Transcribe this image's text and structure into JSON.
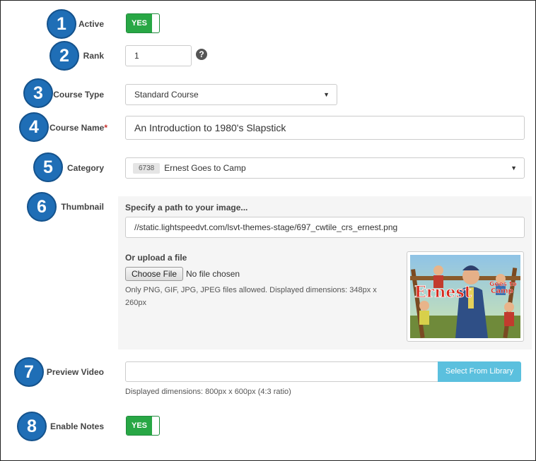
{
  "fields": {
    "active": {
      "num": "1",
      "label": "Active",
      "toggle": "YES"
    },
    "rank": {
      "num": "2",
      "label": "Rank",
      "value": "1",
      "help": "?"
    },
    "course_type": {
      "num": "3",
      "label": "Course Type",
      "value": "Standard Course"
    },
    "course_name": {
      "num": "4",
      "label": "Course Name",
      "required": "*",
      "value": "An Introduction to 1980's Slapstick"
    },
    "category": {
      "num": "5",
      "label": "Category",
      "badge": "6738",
      "value": "Ernest Goes to Camp"
    },
    "thumbnail": {
      "num": "6",
      "label": "Thumbnail",
      "path_title": "Specify a path to your image...",
      "path_value": "//static.lightspeedvt.com/lsvt-themes-stage/697_cwtile_crs_ernest.png",
      "upload_title": "Or upload a file",
      "choose_label": "Choose File",
      "no_file": "No file chosen",
      "hint_line1": "Only PNG, GIF, JPG, JPEG files allowed. Displayed dimensions: 348px x",
      "hint_line2": "260px",
      "image": {
        "title_word": "Ernest",
        "subtitle1": "Goes to",
        "subtitle2": "Camp"
      }
    },
    "preview_video": {
      "num": "7",
      "label": "Preview Video",
      "button": "Select From Library",
      "hint": "Displayed dimensions: 800px x 600px (4:3 ratio)"
    },
    "enable_notes": {
      "num": "8",
      "label": "Enable Notes",
      "toggle": "YES"
    }
  },
  "colors": {
    "step_circle": "#1f6eb6",
    "toggle_green": "#28a745",
    "library_button": "#5bc0de",
    "required": "#c9302c"
  }
}
